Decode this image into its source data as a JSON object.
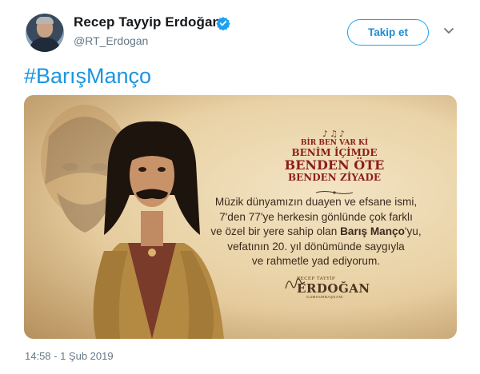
{
  "tweet": {
    "author": {
      "display_name": "Recep Tayyip Erdoğan",
      "handle": "@RT_Erdogan",
      "verified": true
    },
    "follow_button_label": "Takip et",
    "hashtag": "#BarışManço",
    "media": {
      "poem_lines": [
        "BİR BEN VAR Kİ",
        "BENİM İÇİMDE",
        "BENDEN ÖTE",
        "BENDEN ZİYADE"
      ],
      "message_parts": [
        "Müzik dünyamızın duayen ve efsane ismi,",
        "7'den 77'ye herkesin gönlünde çok farklı",
        "ve özel bir yere sahip olan ",
        "Barış Manço",
        "'yu,",
        "vefatının 20. yıl dönümünde saygıyla",
        "ve rahmetle yad ediyorum."
      ],
      "signature": {
        "name_small": "RECEP TAYYİP",
        "surname": "ERDOĞAN",
        "title": "CUMHURBAŞKANI"
      }
    },
    "timestamp": "14:58 - 1 Şub 2019"
  },
  "colors": {
    "accent": "#1da1f2",
    "hashtag": "#1b95e0",
    "muted": "#657786",
    "poem_red": "#8b1e1a"
  },
  "icons": {
    "verified": "verified-badge-icon",
    "caret": "chevron-down-icon"
  }
}
